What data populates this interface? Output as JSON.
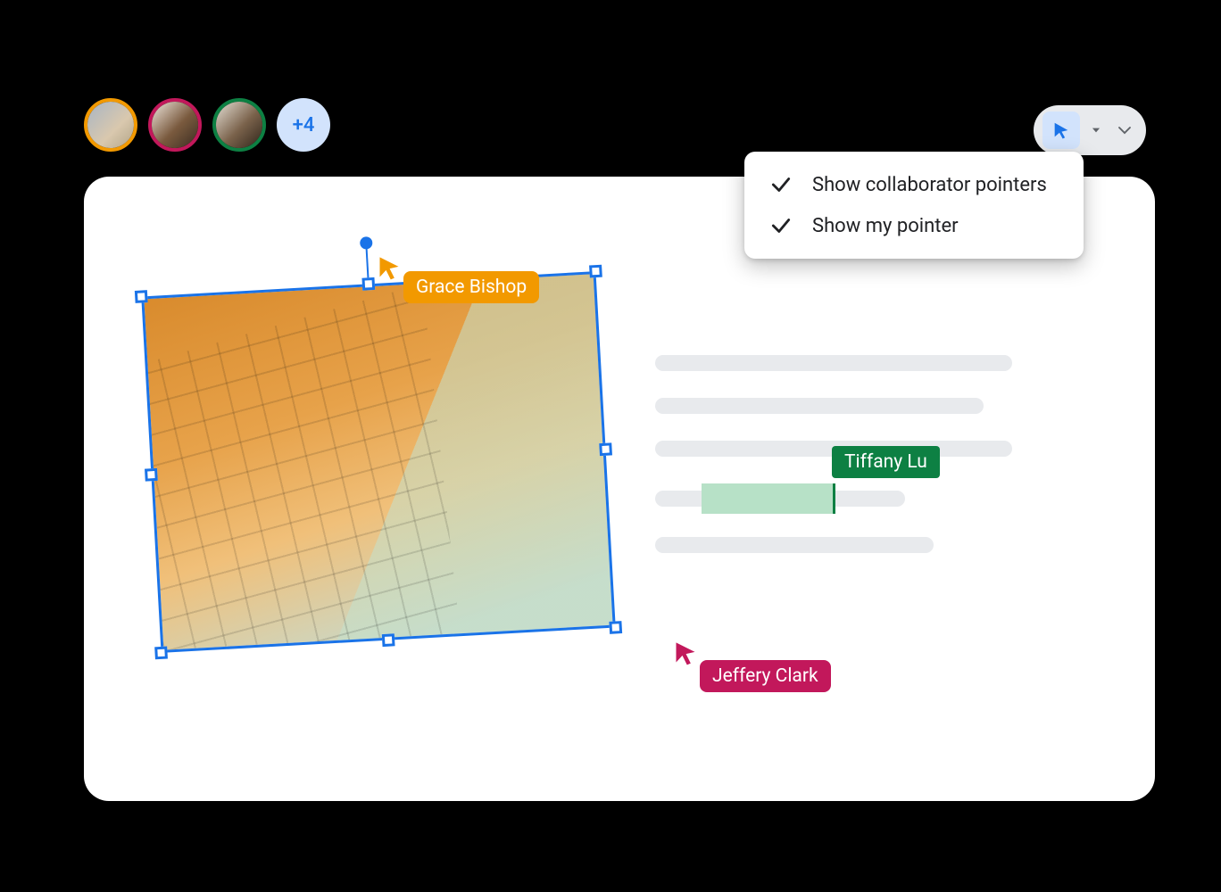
{
  "collaborators": {
    "overflow_label": "+4",
    "avatar_colors": [
      "#f29900",
      "#c2185b",
      "#0d8043"
    ]
  },
  "toolbar": {
    "pointer_selected": true
  },
  "menu": {
    "items": [
      {
        "label": "Show collaborator pointers",
        "checked": true
      },
      {
        "label": "Show my pointer",
        "checked": true
      }
    ]
  },
  "cursors": {
    "grace": {
      "name": "Grace Bishop",
      "color": "#f29900"
    },
    "tiffany": {
      "name": "Tiffany Lu",
      "color": "#0d8043"
    },
    "jeffery": {
      "name": "Jeffery Clark",
      "color": "#c2185b"
    }
  }
}
